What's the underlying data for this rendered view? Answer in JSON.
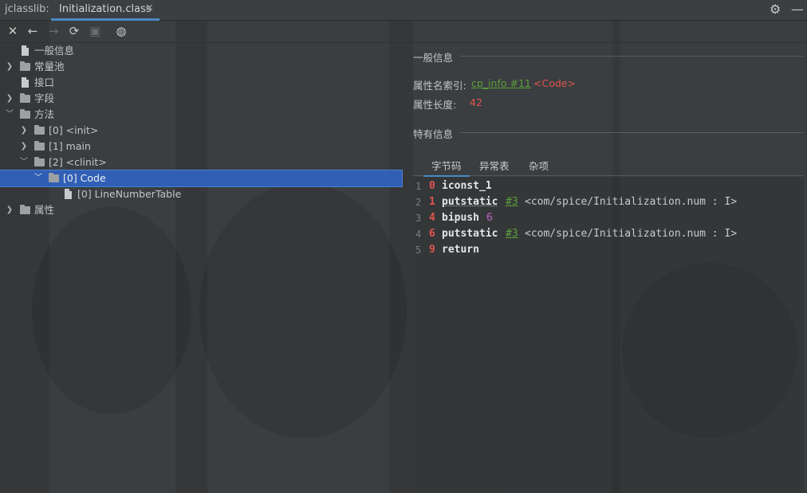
{
  "window": {
    "tool_title": "jclasslib:",
    "tab_label": "Initialization.class",
    "tab_close": "✕",
    "settings_icon": "gear-icon",
    "minimize_icon": "minimize-icon"
  },
  "toolbar": {
    "close": "✕",
    "back": "←",
    "forward": "→",
    "refresh": "⟳",
    "save": "▣",
    "web": "◍"
  },
  "tree": {
    "general_info": "一般信息",
    "constant_pool": "常量池",
    "interfaces": "接口",
    "fields": "字段",
    "methods": "方法",
    "method_0": "[0] <init>",
    "method_1": "[1] main",
    "method_2": "[2] <clinit>",
    "code_attr": "[0] Code",
    "line_number_table": "[0] LineNumberTable",
    "attributes": "属性"
  },
  "detail": {
    "general_section": "一般信息",
    "attr_name_index_label": "属性名索引:",
    "attr_name_index_link": "cp_info #11",
    "attr_name_index_value": "<Code>",
    "attr_length_label": "属性长度:",
    "attr_length_value": "42",
    "specific_section": "特有信息",
    "tabs": [
      "字节码",
      "异常表",
      "杂项"
    ],
    "active_tab": "字节码"
  },
  "bytecode": [
    {
      "line": "1",
      "offset": "0",
      "op": "iconst_1",
      "arg": "",
      "argnum": "",
      "comment": ""
    },
    {
      "line": "2",
      "offset": "1",
      "op": "putstatic",
      "arg": "#3",
      "argnum": "",
      "comment": "<com/spice/Initialization.num : I>"
    },
    {
      "line": "3",
      "offset": "4",
      "op": "bipush",
      "arg": "",
      "argnum": "6",
      "comment": ""
    },
    {
      "line": "4",
      "offset": "6",
      "op": "putstatic",
      "arg": "#3",
      "argnum": "",
      "comment": "<com/spice/Initialization.num : I>"
    },
    {
      "line": "5",
      "offset": "9",
      "op": "return",
      "arg": "",
      "argnum": "",
      "comment": ""
    }
  ],
  "colors": {
    "selection": "#2f65ca",
    "accent": "#4a88c7",
    "link": "#5aa03a",
    "number": "#e0554e",
    "immediate": "#c364c8"
  }
}
